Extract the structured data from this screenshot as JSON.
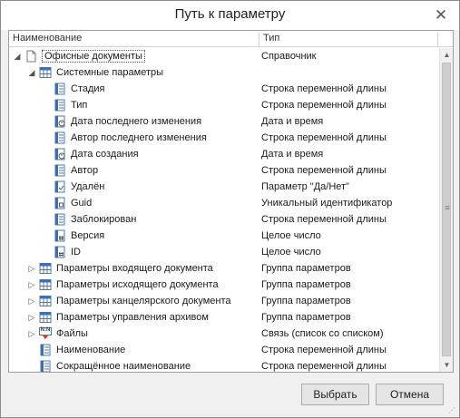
{
  "window": {
    "title": "Путь к параметру",
    "close_glyph": "✕"
  },
  "columns": {
    "name": "Наименование",
    "type": "Тип"
  },
  "rows": [
    {
      "label": "Офисные документы",
      "type": "Справочник",
      "level": 0,
      "expander": "expanded",
      "icon": "document-icon",
      "selected": true
    },
    {
      "label": "Системные параметры",
      "type": "",
      "level": 1,
      "expander": "expanded",
      "icon": "table-icon"
    },
    {
      "label": "Стадия",
      "type": "Строка переменной длины",
      "level": 2,
      "expander": "none",
      "icon": "string-param-icon"
    },
    {
      "label": "Тип",
      "type": "Строка переменной длины",
      "level": 2,
      "expander": "none",
      "icon": "string-param-icon"
    },
    {
      "label": "Дата последнего изменения",
      "type": "Дата и время",
      "level": 2,
      "expander": "none",
      "icon": "date-param-icon"
    },
    {
      "label": "Автор последнего изменения",
      "type": "Строка переменной длины",
      "level": 2,
      "expander": "none",
      "icon": "string-param-icon"
    },
    {
      "label": "Дата создания",
      "type": "Дата и время",
      "level": 2,
      "expander": "none",
      "icon": "date-param-icon"
    },
    {
      "label": "Автор",
      "type": "Строка переменной длины",
      "level": 2,
      "expander": "none",
      "icon": "string-param-icon"
    },
    {
      "label": "Удалён",
      "type": "Параметр \"Да/Нет\"",
      "level": 2,
      "expander": "none",
      "icon": "bool-param-icon"
    },
    {
      "label": "Guid",
      "type": "Уникальный идентификатор",
      "level": 2,
      "expander": "none",
      "icon": "guid-param-icon"
    },
    {
      "label": "Заблокирован",
      "type": "Строка переменной длины",
      "level": 2,
      "expander": "none",
      "icon": "string-param-icon"
    },
    {
      "label": "Версия",
      "type": "Целое число",
      "level": 2,
      "expander": "none",
      "icon": "number-param-icon"
    },
    {
      "label": "ID",
      "type": "Целое число",
      "level": 2,
      "expander": "none",
      "icon": "number-param-icon"
    },
    {
      "label": "Параметры входящего документа",
      "type": "Группа параметров",
      "level": 1,
      "expander": "collapsed",
      "icon": "table-icon"
    },
    {
      "label": "Параметры исходящего документа",
      "type": "Группа параметров",
      "level": 1,
      "expander": "collapsed",
      "icon": "table-icon"
    },
    {
      "label": "Параметры канцелярского документа",
      "type": "Группа параметров",
      "level": 1,
      "expander": "collapsed",
      "icon": "table-icon"
    },
    {
      "label": "Параметры управления архивом",
      "type": "Группа параметров",
      "level": 1,
      "expander": "collapsed",
      "icon": "table-icon"
    },
    {
      "label": "Файлы",
      "type": "Связь (список со списком)",
      "level": 1,
      "expander": "collapsed",
      "icon": "link-list-icon",
      "icon_text": "N:N"
    },
    {
      "label": "Наименование",
      "type": "Строка переменной длины",
      "level": 1,
      "expander": "none",
      "icon": "string-param-icon"
    },
    {
      "label": "Сокращённое наименование",
      "type": "Строка переменной длины",
      "level": 1,
      "expander": "none",
      "icon": "string-param-icon"
    }
  ],
  "buttons": {
    "select": "Выбрать",
    "cancel": "Отмена"
  },
  "scrollbar": {
    "up_glyph": "▲",
    "down_glyph": "▼",
    "grip_glyph": "≡"
  },
  "colors": {
    "icon_blue": "#3c6eb4",
    "icon_border": "#4a78b8",
    "arrow_red": "#d03020"
  }
}
